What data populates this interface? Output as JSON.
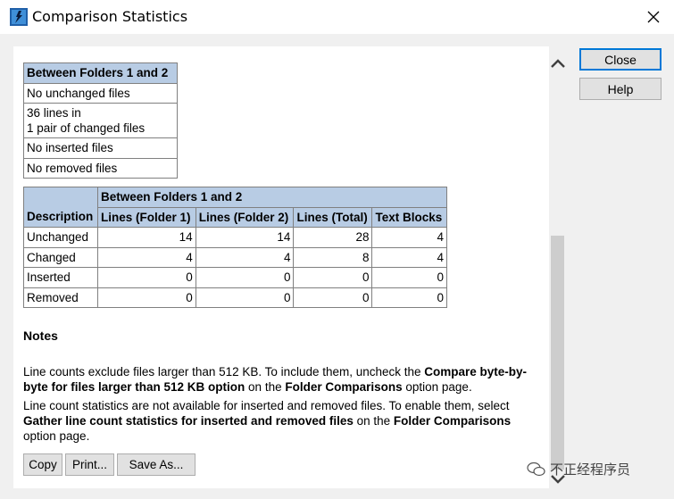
{
  "window": {
    "title": "Comparison Statistics"
  },
  "side_buttons": {
    "close": "Close",
    "help": "Help"
  },
  "summary_table": {
    "header": "Between Folders 1 and 2",
    "rows": [
      "No unchanged files",
      "36 lines in",
      "1 pair of changed files",
      "No inserted files",
      "No removed files"
    ]
  },
  "stats_table": {
    "group_header": "Between Folders 1 and 2",
    "columns": [
      "Description",
      "Lines (Folder 1)",
      "Lines (Folder 2)",
      "Lines (Total)",
      "Text Blocks"
    ],
    "rows": [
      {
        "label": "Unchanged",
        "values": [
          "14",
          "14",
          "28",
          "4"
        ]
      },
      {
        "label": "Changed",
        "values": [
          "4",
          "4",
          "8",
          "4"
        ]
      },
      {
        "label": "Inserted",
        "values": [
          "0",
          "0",
          "0",
          "0"
        ]
      },
      {
        "label": "Removed",
        "values": [
          "0",
          "0",
          "0",
          "0"
        ]
      }
    ]
  },
  "notes": {
    "heading": "Notes",
    "p1_a": "Line counts exclude files larger than 512 KB. To include them, uncheck the ",
    "p1_b": "Compare byte-by-byte for files larger than 512 KB option",
    "p1_c": " on the ",
    "p1_d": "Folder Comparisons",
    "p1_e": " option page.",
    "p2_a": "Line count statistics are not available for inserted and removed files. To enable them, select ",
    "p2_b": "Gather line count statistics for inserted and removed files",
    "p2_c": " on the ",
    "p2_d": "Folder Comparisons",
    "p2_e": " option page."
  },
  "report_buttons": {
    "copy": "Copy",
    "print": "Print...",
    "save_as": "Save As..."
  },
  "watermark": {
    "text": "不正经程序员"
  }
}
